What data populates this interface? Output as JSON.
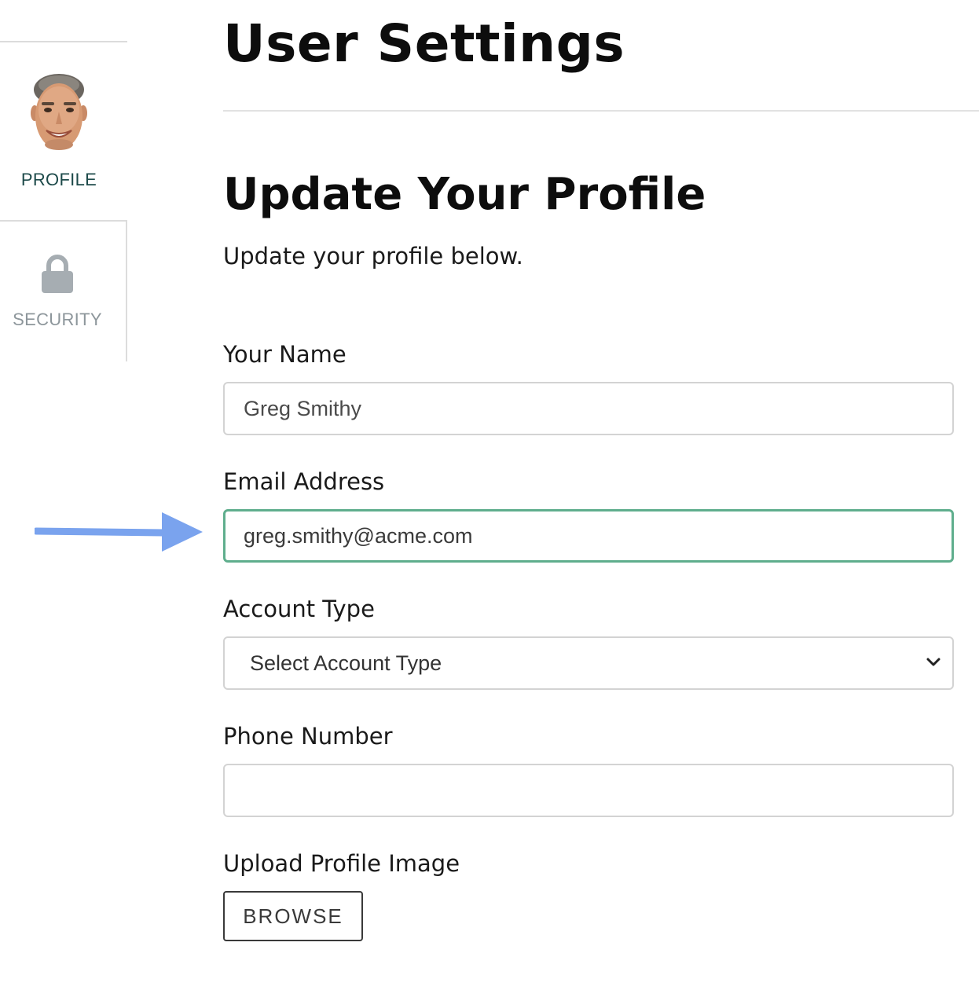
{
  "header": {
    "title": "User Settings"
  },
  "sidebar": {
    "items": [
      {
        "label": "PROFILE",
        "icon": "avatar",
        "active": true
      },
      {
        "label": "SECURITY",
        "icon": "lock-icon",
        "active": false
      }
    ]
  },
  "profile_form": {
    "title": "Update Your Profile",
    "subtitle": "Update your profile below.",
    "name": {
      "label": "Your Name",
      "value": "Greg Smithy"
    },
    "email": {
      "label": "Email Address",
      "value": "greg.smithy@acme.com",
      "focused": true
    },
    "account_type": {
      "label": "Account Type",
      "selected": "Select Account Type"
    },
    "phone": {
      "label": "Phone Number",
      "value": ""
    },
    "upload": {
      "label": "Upload Profile Image",
      "button_label": "BROWSE"
    }
  },
  "annotation": {
    "arrow_color": "#7aa3ee",
    "points_to": "email-field"
  },
  "colors": {
    "focus_border": "#5fae8d",
    "active_nav_text": "#1d4a4a",
    "inactive_nav_text": "#8d969b"
  }
}
